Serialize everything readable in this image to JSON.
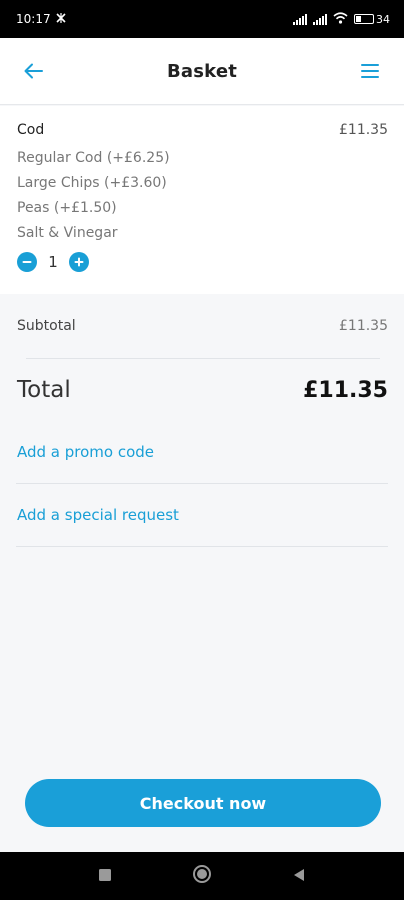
{
  "status_bar": {
    "time": "10:17",
    "battery": "34"
  },
  "header": {
    "title": "Basket",
    "back_icon": "arrow-left-icon",
    "menu_icon": "hamburger-menu-icon"
  },
  "basket": {
    "items": [
      {
        "name": "Cod",
        "price": "£11.35",
        "options": [
          "Regular Cod (+£6.25)",
          "Large Chips (+£3.60)",
          "Peas (+£1.50)",
          "Salt & Vinegar"
        ],
        "quantity": "1"
      }
    ]
  },
  "summary": {
    "subtotal_label": "Subtotal",
    "subtotal_value": "£11.35",
    "total_label": "Total",
    "total_value": "£11.35"
  },
  "links": {
    "promo": "Add a promo code",
    "special_request": "Add a special request"
  },
  "checkout": {
    "label": "Checkout now"
  },
  "colors": {
    "accent": "#1a9fd8",
    "background": "#f6f7f9"
  }
}
